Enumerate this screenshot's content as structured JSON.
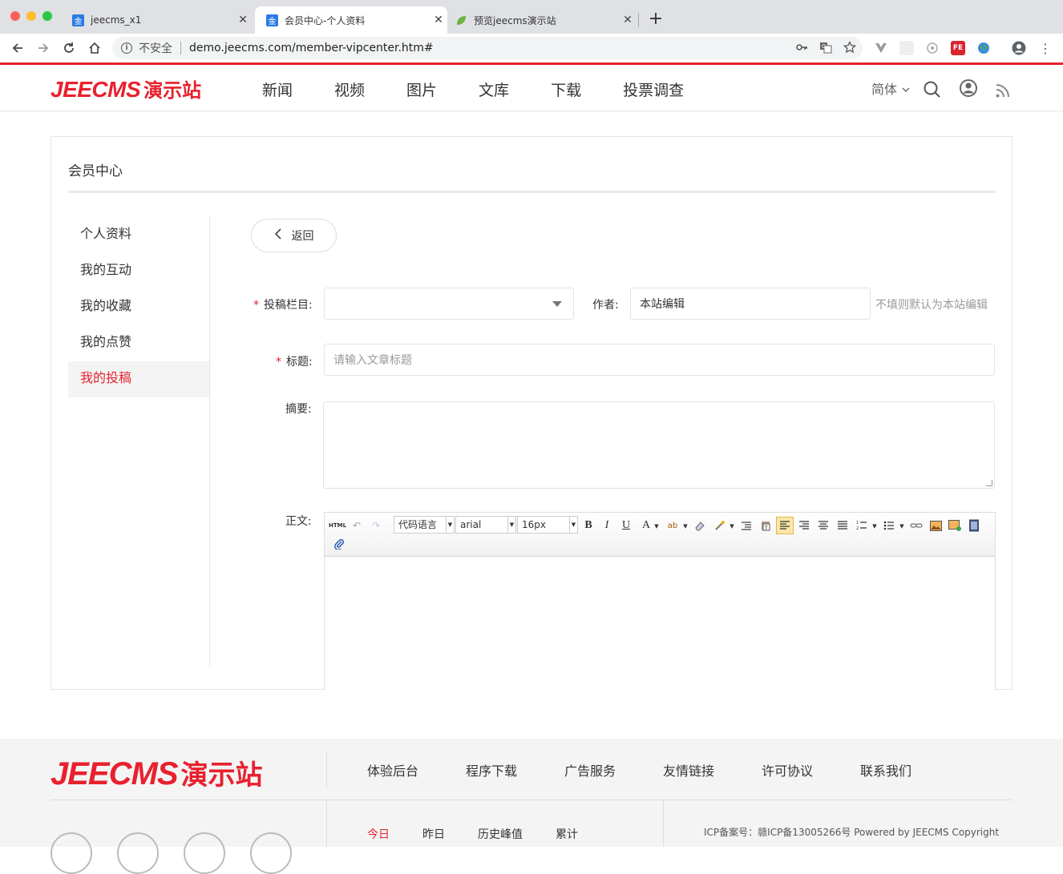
{
  "browser": {
    "tabs": [
      {
        "title": "jeecms_x1",
        "favicon": "金",
        "active": false
      },
      {
        "title": "会员中心-个人资料",
        "favicon": "金",
        "active": true
      },
      {
        "title": "预览jeecms演示站",
        "favicon": "leaf",
        "active": false
      }
    ],
    "security_label": "不安全",
    "url": "demo.jeecms.com/member-vipcenter.htm#"
  },
  "site": {
    "logo_en": "JEECMS",
    "logo_cn": "演示站",
    "nav": [
      "新闻",
      "视频",
      "图片",
      "文库",
      "下载",
      "投票调查"
    ],
    "lang": "简体",
    "accent_color": "#e8212d"
  },
  "member": {
    "title": "会员中心",
    "menu": [
      {
        "label": "个人资料",
        "active": false
      },
      {
        "label": "我的互动",
        "active": false
      },
      {
        "label": "我的收藏",
        "active": false
      },
      {
        "label": "我的点赞",
        "active": false
      },
      {
        "label": "我的投稿",
        "active": true
      }
    ],
    "back_label": "返回",
    "form": {
      "column_label": "投稿栏目:",
      "column_value": "",
      "author_label": "作者:",
      "author_value": "本站编辑",
      "author_hint": "不填则默认为本站编辑",
      "title_label": "标题:",
      "title_placeholder": "请输入文章标题",
      "summary_label": "摘要:",
      "body_label": "正文:",
      "required_mark": "*"
    },
    "editor": {
      "html_btn": "HTML",
      "code_lang": "代码语言",
      "font_family": "arial",
      "font_size": "16px",
      "bold": "B",
      "italic": "I",
      "underline": "U",
      "font_color": "A"
    }
  },
  "footer": {
    "logo_en": "JEECMS",
    "logo_cn": "演示站",
    "links": [
      "体验后台",
      "程序下载",
      "广告服务",
      "友情链接",
      "许可协议",
      "联系我们"
    ],
    "stats": [
      "今日",
      "昨日",
      "历史峰值",
      "累计"
    ],
    "icp": "ICP备案号：赣ICP备13005266号 Powered by JEECMS Copyright"
  }
}
